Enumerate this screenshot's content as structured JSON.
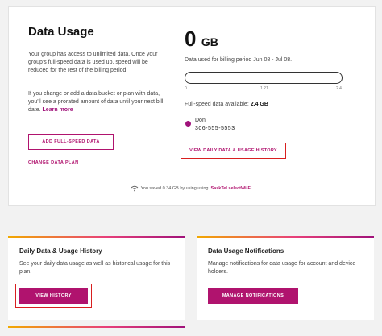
{
  "usage": {
    "title": "Data Usage",
    "desc1": "Your group has access to unlimited data. Once your group's full-speed data is used up, speed will be reduced for the rest of the billing period.",
    "desc2": "If you change or add a data bucket or plan with data, you'll see a prorated amount of data until your next bill date.",
    "learn_more": "Learn more",
    "add_button": "ADD FULL-SPEED DATA",
    "change_plan": "CHANGE DATA PLAN",
    "amount_value": "0",
    "amount_unit": "GB",
    "period": "Data used for billing period Jun 08 - Jul 08.",
    "progress_fraction": 0,
    "ticks": [
      "0",
      "1.21",
      "2.4"
    ],
    "fullspeed_label": "Full-speed data available:",
    "fullspeed_value": "2.4 GB",
    "user": {
      "name": "Don",
      "phone": "306-555-5553",
      "color": "#a0127a"
    },
    "history_link": "VIEW DAILY DATA & USAGE HISTORY"
  },
  "wifi": {
    "icon": "wifi-icon",
    "text_before": "You saved 0.34 GB by using using",
    "brand": "SaskTel selectWi-Fi"
  },
  "history_card": {
    "title": "Daily Data & Usage History",
    "desc": "See your daily data usage as well as historical usage for this plan.",
    "button": "VIEW HISTORY"
  },
  "notifications_card": {
    "title": "Data Usage Notifications",
    "desc": "Manage notifications for data usage for account and device holders.",
    "button": "MANAGE NOTIFICATIONS"
  },
  "colors": {
    "accent": "#b0136e",
    "highlight": "#d81f1f",
    "gradient_start": "#f2a900",
    "gradient_end": "#a0127a"
  }
}
